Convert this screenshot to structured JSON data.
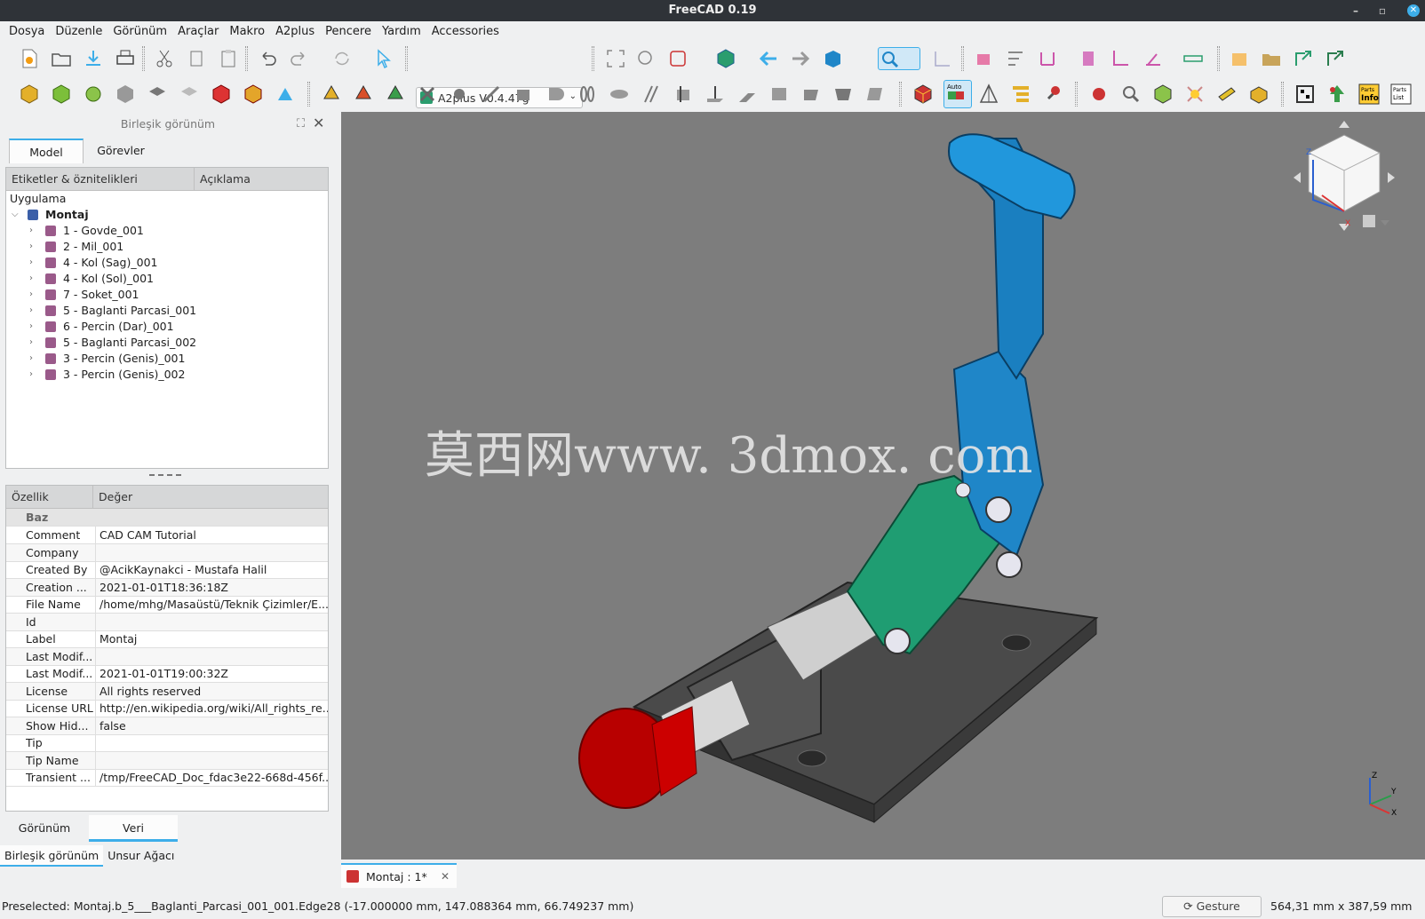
{
  "window": {
    "title": "FreeCAD 0.19",
    "minimize_glyph": "–",
    "restore_glyph": "▫",
    "close_glyph": "✕"
  },
  "menu": [
    "Dosya",
    "Düzenle",
    "Görünüm",
    "Araçlar",
    "Makro",
    "A2plus",
    "Pencere",
    "Yardım",
    "Accessories"
  ],
  "toolbar": {
    "workbench_selector": "A2plus V0.4.47g",
    "caret": "⌄"
  },
  "left_panel": {
    "title": "Birleşik görünüm",
    "tabs": [
      "Model",
      "Görevler"
    ],
    "tree": {
      "headers": [
        "Etiketler & öznitelikleri",
        "Açıklama"
      ],
      "root_label": "Uygulama",
      "document": "Montaj",
      "items": [
        "1 - Govde_001",
        "2 - Mil_001",
        "4 - Kol (Sag)_001",
        "4 - Kol (Sol)_001",
        "7 - Soket_001",
        "5 - Baglanti Parcasi_001",
        "6 - Percin (Dar)_001",
        "5 - Baglanti Parcasi_002",
        "3 - Percin (Genis)_001",
        "3 - Percin (Genis)_002"
      ]
    },
    "properties": {
      "headers": [
        "Özellik",
        "Değer"
      ],
      "group": "Baz",
      "rows": [
        {
          "k": "Comment",
          "v": "CAD CAM Tutorial"
        },
        {
          "k": "Company",
          "v": ""
        },
        {
          "k": "Created By",
          "v": "@AcikKaynakci - Mustafa Halil"
        },
        {
          "k": "Creation ...",
          "v": "2021-01-01T18:36:18Z"
        },
        {
          "k": "File Name",
          "v": "/home/mhg/Masaüstü/Teknik Çizimler/E..."
        },
        {
          "k": "Id",
          "v": ""
        },
        {
          "k": "Label",
          "v": "Montaj"
        },
        {
          "k": "Last Modif...",
          "v": ""
        },
        {
          "k": "Last Modif...",
          "v": "2021-01-01T19:00:32Z"
        },
        {
          "k": "License",
          "v": "All rights reserved"
        },
        {
          "k": "License URL",
          "v": "http://en.wikipedia.org/wiki/All_rights_re..."
        },
        {
          "k": "Show Hid...",
          "v": "false"
        },
        {
          "k": "Tip",
          "v": ""
        },
        {
          "k": "Tip Name",
          "v": ""
        },
        {
          "k": "Transient ...",
          "v": "/tmp/FreeCAD_Doc_fdac3e22-668d-456f..."
        }
      ]
    },
    "property_tabs": [
      "Görünüm",
      "Veri"
    ],
    "bottom_tabs": [
      "Birleşik görünüm",
      "Unsur Ağacı"
    ]
  },
  "viewport": {
    "watermark": "莫西网www. 3dmox. com",
    "axis_x": "X",
    "axis_y": "Y",
    "axis_z": "Z"
  },
  "doc_tab": {
    "label": "Montaj : 1*",
    "close": "✕"
  },
  "status": {
    "preselected": "Preselected: Montaj.b_5___Baglanti_Parcasi_001_001.Edge28 (-17.000000 mm, 147.088364 mm, 66.749237 mm)",
    "nav_style": "Gesture",
    "dimensions": "564,31 mm x 387,59 mm"
  },
  "colors": {
    "accent": "#3daee9",
    "handle": "#1f86c8",
    "link": "#2a9d6e",
    "base": "#555555",
    "knob": "#cc0000"
  }
}
